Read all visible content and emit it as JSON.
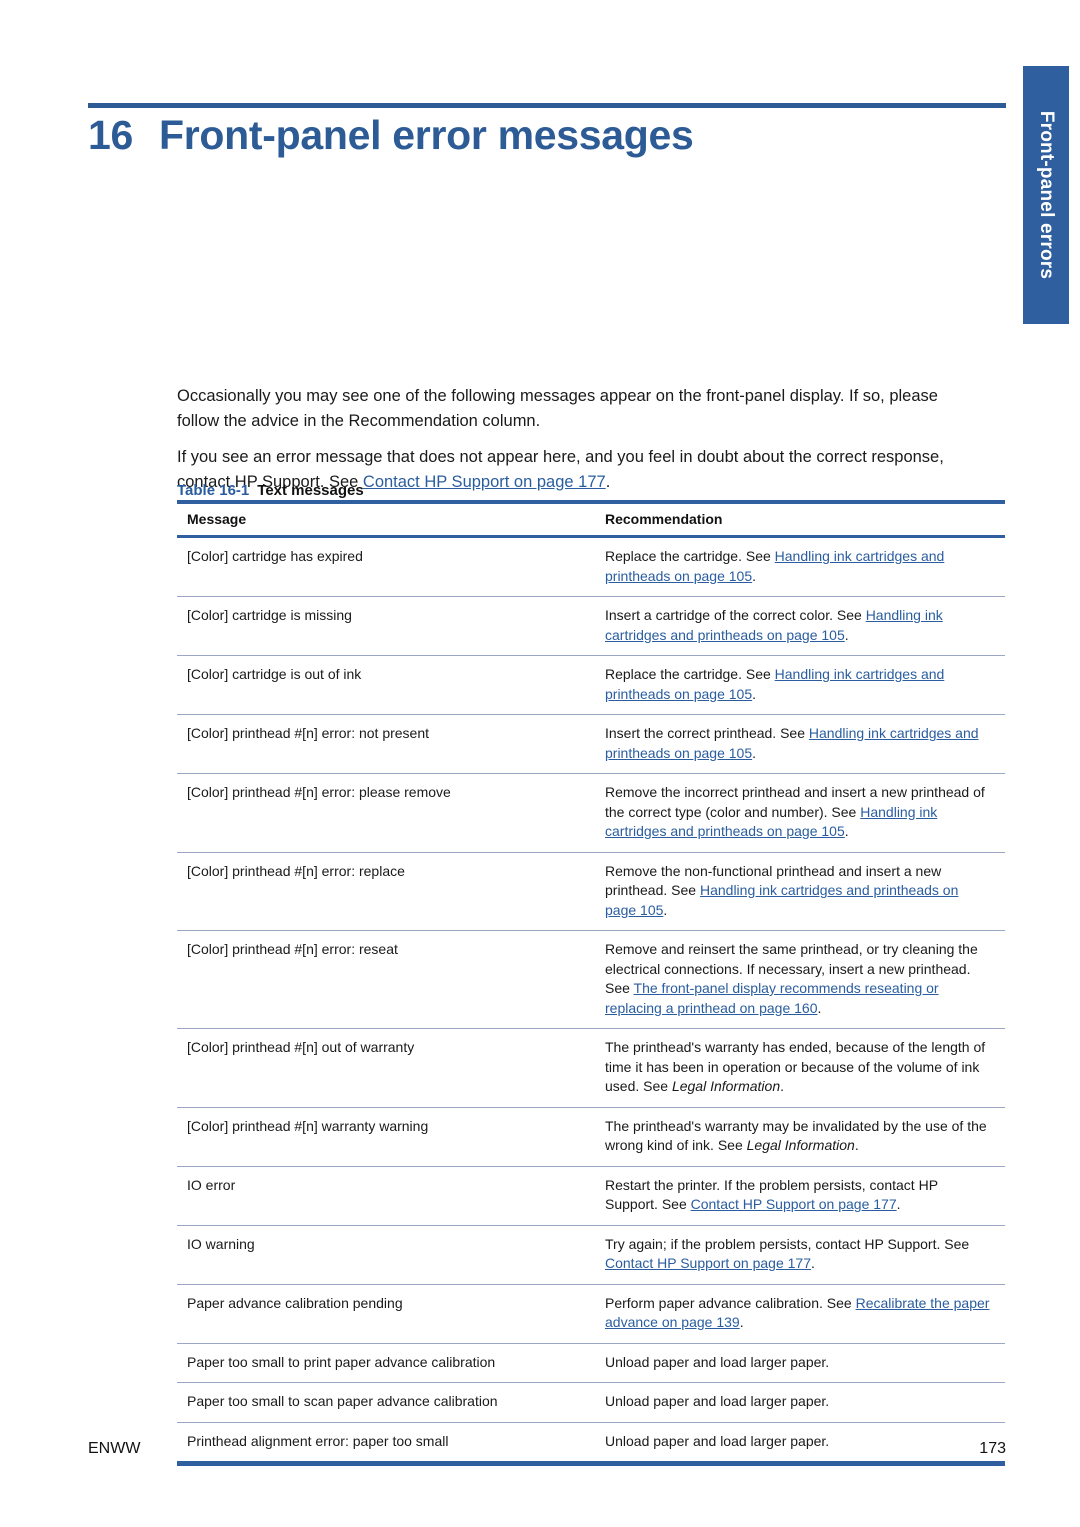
{
  "page": {
    "chapter_number": "16",
    "chapter_title": "Front-panel error messages",
    "side_tab_label": "Front-panel errors",
    "accent_color": "#2f5f9e",
    "link_color": "#2a5d9f",
    "footer_left": "ENWW",
    "footer_right": "173"
  },
  "intro": {
    "paragraph_1": "Occasionally you may see one of the following messages appear on the front-panel display. If so, please follow the advice in the Recommendation column.",
    "paragraph_2_before": "If you see an error message that does not appear here, and you feel in doubt about the correct response, contact HP Support. See ",
    "paragraph_2_link": "Contact HP Support on page 177",
    "paragraph_2_after": "."
  },
  "table": {
    "caption_number": "Table 16-1",
    "caption_title": "Text messages",
    "columns": [
      "Message",
      "Recommendation"
    ],
    "rows": [
      {
        "message": "[Color] cartridge has expired",
        "recommendation_parts": [
          {
            "type": "text",
            "text": "Replace the cartridge. See "
          },
          {
            "type": "link",
            "text": "Handling ink cartridges and printheads on page 105"
          },
          {
            "type": "text",
            "text": "."
          }
        ]
      },
      {
        "message": "[Color] cartridge is missing",
        "recommendation_parts": [
          {
            "type": "text",
            "text": "Insert a cartridge of the correct color. See "
          },
          {
            "type": "link",
            "text": "Handling ink cartridges and printheads on page 105"
          },
          {
            "type": "text",
            "text": "."
          }
        ]
      },
      {
        "message": "[Color] cartridge is out of ink",
        "recommendation_parts": [
          {
            "type": "text",
            "text": "Replace the cartridge. See "
          },
          {
            "type": "link",
            "text": "Handling ink cartridges and printheads on page 105"
          },
          {
            "type": "text",
            "text": "."
          }
        ]
      },
      {
        "message": "[Color] printhead #[n] error: not present",
        "recommendation_parts": [
          {
            "type": "text",
            "text": "Insert the correct printhead. See "
          },
          {
            "type": "link",
            "text": "Handling ink cartridges and printheads on page 105"
          },
          {
            "type": "text",
            "text": "."
          }
        ]
      },
      {
        "message": "[Color] printhead #[n] error: please remove",
        "recommendation_parts": [
          {
            "type": "text",
            "text": "Remove the incorrect printhead and insert a new printhead of the correct type (color and number). See "
          },
          {
            "type": "link",
            "text": "Handling ink cartridges and printheads on page 105"
          },
          {
            "type": "text",
            "text": "."
          }
        ]
      },
      {
        "message": "[Color] printhead #[n] error: replace",
        "recommendation_parts": [
          {
            "type": "text",
            "text": "Remove the non-functional printhead and insert a new printhead. See "
          },
          {
            "type": "link",
            "text": "Handling ink cartridges and printheads on page 105"
          },
          {
            "type": "text",
            "text": "."
          }
        ]
      },
      {
        "message": "[Color] printhead #[n] error: reseat",
        "recommendation_parts": [
          {
            "type": "text",
            "text": "Remove and reinsert the same printhead, or try cleaning the electrical connections. If necessary, insert a new printhead. See "
          },
          {
            "type": "link",
            "text": "The front-panel display recommends reseating or replacing a printhead on page 160"
          },
          {
            "type": "text",
            "text": "."
          }
        ]
      },
      {
        "message": "[Color] printhead #[n] out of warranty",
        "recommendation_parts": [
          {
            "type": "text",
            "text": "The printhead's warranty has ended, because of the length of time it has been in operation or because of the volume of ink used. See "
          },
          {
            "type": "italic",
            "text": "Legal Information"
          },
          {
            "type": "text",
            "text": "."
          }
        ]
      },
      {
        "message": "[Color] printhead #[n] warranty warning",
        "recommendation_parts": [
          {
            "type": "text",
            "text": "The printhead's warranty may be invalidated by the use of the wrong kind of ink. See "
          },
          {
            "type": "italic",
            "text": "Legal Information"
          },
          {
            "type": "text",
            "text": "."
          }
        ]
      },
      {
        "message": "IO error",
        "recommendation_parts": [
          {
            "type": "text",
            "text": "Restart the printer. If the problem persists, contact HP Support. See "
          },
          {
            "type": "link",
            "text": "Contact HP Support on page 177"
          },
          {
            "type": "text",
            "text": "."
          }
        ]
      },
      {
        "message": "IO warning",
        "recommendation_parts": [
          {
            "type": "text",
            "text": "Try again; if the problem persists, contact HP Support. See "
          },
          {
            "type": "link",
            "text": "Contact HP Support on page 177"
          },
          {
            "type": "text",
            "text": "."
          }
        ]
      },
      {
        "message": "Paper advance calibration pending",
        "recommendation_parts": [
          {
            "type": "text",
            "text": "Perform paper advance calibration. See "
          },
          {
            "type": "link",
            "text": "Recalibrate the paper advance on page 139"
          },
          {
            "type": "text",
            "text": "."
          }
        ]
      },
      {
        "message": "Paper too small to print paper advance calibration",
        "recommendation_parts": [
          {
            "type": "text",
            "text": "Unload paper and load larger paper."
          }
        ]
      },
      {
        "message": "Paper too small to scan paper advance calibration",
        "recommendation_parts": [
          {
            "type": "text",
            "text": "Unload paper and load larger paper."
          }
        ]
      },
      {
        "message": "Printhead alignment error: paper too small",
        "recommendation_parts": [
          {
            "type": "text",
            "text": "Unload paper and load larger paper."
          }
        ]
      }
    ]
  }
}
